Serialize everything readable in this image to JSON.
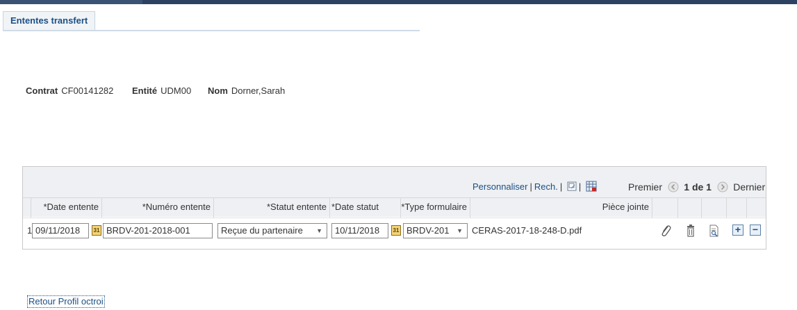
{
  "tab": {
    "label": "Ententes transfert"
  },
  "info": {
    "contrat_label": "Contrat",
    "contrat_value": "CF00141282",
    "entite_label": "Entité",
    "entite_value": "UDM00",
    "nom_label": "Nom",
    "nom_value": "Dorner,Sarah"
  },
  "grid": {
    "toolbar": {
      "personnaliser": "Personnaliser",
      "sep1": "|",
      "rech": "Rech.",
      "sep2": "|",
      "sep3": "|",
      "premier": "Premier",
      "page_info": "1 de 1",
      "dernier": "Dernier"
    },
    "columns": {
      "date_entente": "*Date entente",
      "numero_entente": "*Numéro entente",
      "statut_entente": "*Statut entente",
      "date_statut": "*Date statut",
      "type_formulaire": "*Type formulaire",
      "piece_jointe": "Pièce jointe"
    },
    "rows": [
      {
        "num": "1",
        "date_entente": "09/11/2018",
        "numero_entente": "BRDV-201-2018-001",
        "statut_entente": "Reçue du partenaire",
        "date_statut": "10/11/2018",
        "type_formulaire": "BRDV-201",
        "piece_jointe": "CERAS-2017-18-248-D.pdf"
      }
    ],
    "calendar_icon_text": "31"
  },
  "footer": {
    "retour_link": "Retour Profil octroi"
  },
  "colors": {
    "topbar": "#2d4163",
    "link": "#1b4f84",
    "header_bg": "#eef0f3"
  },
  "icons": [
    "calendar-icon",
    "attach-icon",
    "trash-icon",
    "view-icon",
    "add-row-icon",
    "delete-row-icon",
    "zoom-icon",
    "download-icon",
    "prev-icon",
    "next-icon"
  ]
}
